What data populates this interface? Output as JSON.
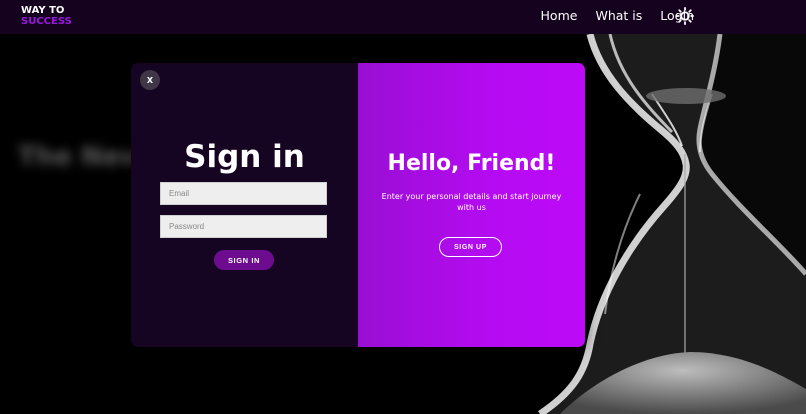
{
  "navbar": {
    "logo_line1": "WAY TO",
    "logo_line2": "SUCCESS",
    "links": [
      "Home",
      "What is",
      "Login"
    ],
    "theme_icon": "sun-icon"
  },
  "hero": {
    "blurred_text": "The New ... To"
  },
  "modal": {
    "close_label": "X",
    "signin": {
      "title": "Sign in",
      "email_placeholder": "Email",
      "password_placeholder": "Password",
      "button_label": "SIGN IN"
    },
    "overlay": {
      "title": "Hello, Friend!",
      "text": "Enter your personal details and start journey with us",
      "button_label": "SIGN UP"
    }
  },
  "colors": {
    "navbar_bg": "#14021f",
    "accent": "#9b17e0",
    "modal_left_bg": "#160522",
    "modal_right_bg": "#b50bf2",
    "signin_button": "#6d0c8f"
  }
}
